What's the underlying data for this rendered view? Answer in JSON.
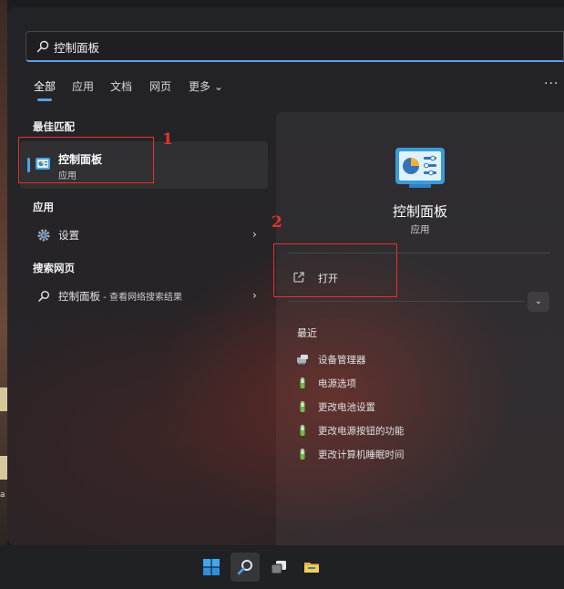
{
  "search": {
    "value": "控制面板"
  },
  "tabs": [
    {
      "label": "全部"
    },
    {
      "label": "应用"
    },
    {
      "label": "文档"
    },
    {
      "label": "网页"
    },
    {
      "label": "更多 ⌄"
    }
  ],
  "more_options": "···",
  "sections": {
    "best_match": "最佳匹配",
    "apps": "应用",
    "web": "搜索网页"
  },
  "best_match": {
    "title": "控制面板",
    "subtitle": "应用"
  },
  "apps_items": [
    {
      "label": "设置"
    }
  ],
  "web_items": [
    {
      "label": "控制面板",
      "suffix": " - 查看网络搜索结果"
    }
  ],
  "detail": {
    "title": "控制面板",
    "subtitle": "应用",
    "actions": [
      {
        "label": "打开"
      }
    ],
    "expand": "⌄",
    "recent_label": "最近",
    "recent_items": [
      {
        "label": "设备管理器",
        "icon": "device-manager-icon"
      },
      {
        "label": "电源选项",
        "icon": "power-options-icon"
      },
      {
        "label": "更改电池设置",
        "icon": "power-options-icon"
      },
      {
        "label": "更改电源按钮的功能",
        "icon": "power-options-icon"
      },
      {
        "label": "更改计算机睡眠时间",
        "icon": "power-options-icon"
      }
    ]
  },
  "annotations": [
    {
      "label": "1"
    },
    {
      "label": "2"
    }
  ],
  "desktop_glyph": "a",
  "colors": {
    "accent": "#5a9fe6",
    "annotation": "#e8322c"
  }
}
